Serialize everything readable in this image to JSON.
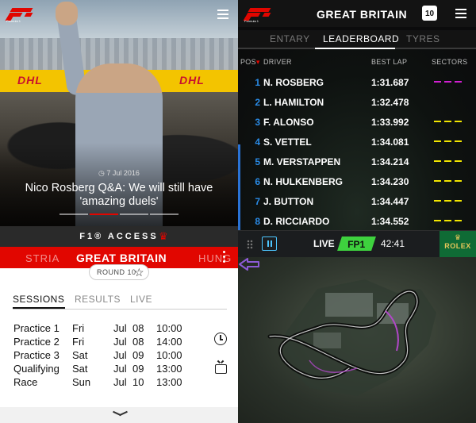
{
  "left": {
    "article": {
      "date": "7 Jul 2016",
      "title": "Nico Rosberg Q&A: We will still have 'amazing duels'",
      "banner_text": "DHL",
      "logo_subtitle": "Formula 1"
    },
    "access_label": "F1® ACCESS",
    "race_selector": {
      "prev": "STRIA",
      "current": "GREAT BRITAIN",
      "next": "HUNG"
    },
    "round_label": "ROUND 10",
    "tabs": [
      {
        "label": "SESSIONS",
        "active": true
      },
      {
        "label": "RESULTS",
        "active": false
      },
      {
        "label": "LIVE",
        "active": false
      }
    ],
    "sessions": [
      {
        "name": "Practice 1",
        "day": "Fri",
        "month": "Jul",
        "date": "08",
        "time": "10:00"
      },
      {
        "name": "Practice 2",
        "day": "Fri",
        "month": "Jul",
        "date": "08",
        "time": "14:00"
      },
      {
        "name": "Practice 3",
        "day": "Sat",
        "month": "Jul",
        "date": "09",
        "time": "10:00"
      },
      {
        "name": "Qualifying",
        "day": "Sat",
        "month": "Jul",
        "date": "09",
        "time": "13:00"
      },
      {
        "name": "Race",
        "day": "Sun",
        "month": "Jul",
        "date": "10",
        "time": "13:00"
      }
    ]
  },
  "right": {
    "title": "GREAT BRITAIN",
    "calendar_day": "10",
    "logo_subtitle": "Formula 1",
    "tabs": [
      {
        "label": "ENTARY",
        "active": false
      },
      {
        "label": "LEADERBOARD",
        "active": true
      },
      {
        "label": "TYRES",
        "active": false
      }
    ],
    "headers": {
      "pos": "POS",
      "pos_marker": "▾",
      "driver": "DRIVER",
      "best_lap": "BEST LAP",
      "sectors": "SECTORS"
    },
    "leaderboard": [
      {
        "pos": "1",
        "driver": "N. ROSBERG",
        "lap": "1:31.687",
        "sector_color": "#d21ed2"
      },
      {
        "pos": "2",
        "driver": "L. HAMILTON",
        "lap": "1:32.478",
        "sector_color": ""
      },
      {
        "pos": "3",
        "driver": "F. ALONSO",
        "lap": "1:33.992",
        "sector_color": "#f2e600"
      },
      {
        "pos": "4",
        "driver": "S. VETTEL",
        "lap": "1:34.081",
        "sector_color": "#f2e600"
      },
      {
        "pos": "5",
        "driver": "M. VERSTAPPEN",
        "lap": "1:34.214",
        "sector_color": "#f2e600"
      },
      {
        "pos": "6",
        "driver": "N. HULKENBERG",
        "lap": "1:34.230",
        "sector_color": "#f2e600"
      },
      {
        "pos": "7",
        "driver": "J. BUTTON",
        "lap": "1:34.447",
        "sector_color": "#f2e600"
      },
      {
        "pos": "8",
        "driver": "D. RICCIARDO",
        "lap": "1:34.552",
        "sector_color": "#f2e600"
      }
    ],
    "live": {
      "label": "LIVE",
      "session": "FP1",
      "clock": "42:41",
      "sponsor": "ROLEX",
      "sponsor_mark": "♛"
    }
  },
  "colors": {
    "f1_red": "#e10600",
    "position_blue": "#2a8be6",
    "fp_green": "#3ed13e",
    "rolex_green": "#0f6b35",
    "fastest_sector": "#d21ed2",
    "personal_sector": "#f2e600"
  }
}
